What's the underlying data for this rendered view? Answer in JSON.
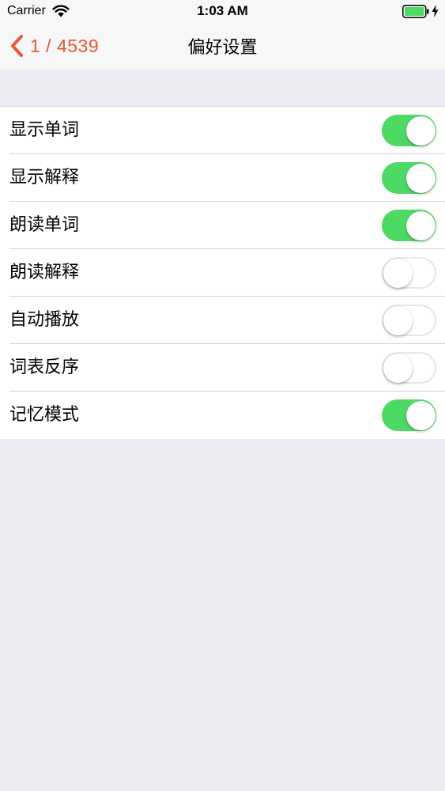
{
  "status_bar": {
    "carrier": "Carrier",
    "time": "1:03 AM",
    "wifi_icon": "wifi-icon",
    "battery_icon": "battery-icon",
    "charging_icon": "bolt-icon"
  },
  "nav": {
    "back_icon": "chevron-left-icon",
    "back_label": "1 / 4539",
    "title": "偏好设置",
    "accent_color": "#ec5632"
  },
  "colors": {
    "toggle_on": "#4cd964",
    "background": "#ebeaf1"
  },
  "settings": [
    {
      "label": "显示单词",
      "on": true
    },
    {
      "label": "显示解释",
      "on": true
    },
    {
      "label": "朗读单词",
      "on": true
    },
    {
      "label": "朗读解释",
      "on": false
    },
    {
      "label": "自动播放",
      "on": false
    },
    {
      "label": "词表反序",
      "on": false
    },
    {
      "label": "记忆模式",
      "on": true
    }
  ]
}
